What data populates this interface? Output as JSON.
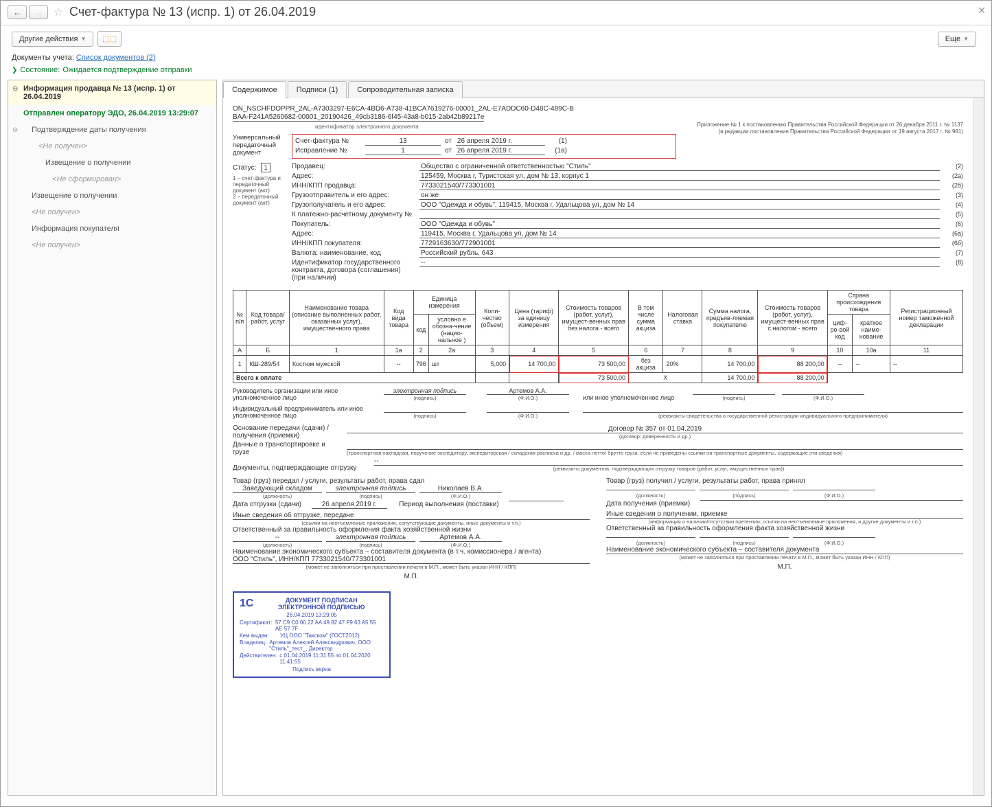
{
  "title": "Счет-фактура № 13 (испр. 1) от 26.04.2019",
  "toolbar": {
    "other_actions": "Другие действия",
    "more": "Еще"
  },
  "linkrow": {
    "label": "Документы учета:",
    "link": "Список документов (2)"
  },
  "statusrow": {
    "label": "Состояние:",
    "value": "Ожидается подтверждение отправки"
  },
  "sidebar": {
    "hdr1": "Информация продавца № 13 (испр. 1) от 26.04.2019",
    "hdr2": "Отправлен оператору ЭДО, 26.04.2019 13:29:07",
    "items": [
      {
        "label": "Подтверждение даты получения",
        "class": "side-indent",
        "bullet": "⊖"
      },
      {
        "label": "<Не получен>",
        "class": "side-faded"
      },
      {
        "label": "Извещение о получении",
        "class": "side-indent",
        "indent": "padding-left:54px"
      },
      {
        "label": "<Не сформирован>",
        "class": "side-faded",
        "indent": "padding-left:64px"
      },
      {
        "label": "Извещение о получении",
        "class": "side-indent"
      },
      {
        "label": "<Не получен>",
        "class": "side-faded2"
      },
      {
        "label": "Информация покупателя",
        "class": "side-indent"
      },
      {
        "label": "<Не получен>",
        "class": "side-faded2"
      }
    ]
  },
  "tabs": [
    {
      "label": "Содержимое",
      "active": true
    },
    {
      "label": "Подписи (1)",
      "active": false
    },
    {
      "label": "Сопроводительная записка",
      "active": false
    }
  ],
  "doc": {
    "file1": "ON_NSCHFDOPPR_2AL-A7303297-E6CA-4BD6-A738-41BCA7619276-00001_2AL-E7ADDC60-D48C-489C-B",
    "file2": "BAA-F241A5260682-00001_20190426_49cb3186-6f45-43a8-b015-2ab42b89217e",
    "file_cap": "идентификатор электронного документа",
    "appendix1": "Приложение № 1 к постановлению Правительства Российской Федерации от 26 декабря 2011 г. № 1137",
    "appendix2": "(в редакции постановления Правительства Российской Федерации от 19 августа 2017 г. № 981)",
    "upd_label": "Универсальный передаточный документ",
    "sf_label": "Счет-фактура №",
    "sf_num": "13",
    "sf_ot": "от",
    "sf_date": "26 апреля 2019 г.",
    "sf_lineno": "(1)",
    "ispr_label": "Исправление №",
    "ispr_num": "1",
    "ispr_date": "26 апреля 2019 г.",
    "ispr_lineno": "(1а)",
    "status_label": "Статус:",
    "status_val": "1",
    "status_note1": "1 – счет-фактура и передаточный документ (акт)",
    "status_note2": "2 – передаточный документ (акт)",
    "rows": [
      {
        "k": "Продавец:",
        "v": "Общество с ограниченной ответственностью \"Стиль\"",
        "n": "(2)"
      },
      {
        "k": "Адрес:",
        "v": "125459, Москва г, Туристская ул, дом № 13, корпус 1",
        "n": "(2а)"
      },
      {
        "k": "ИНН/КПП продавца:",
        "v": "7733021540/773301001",
        "n": "(2б)"
      },
      {
        "k": "Грузоотправитель и его адрес:",
        "v": "он же",
        "n": "(3)"
      },
      {
        "k": "Грузополучатель и его адрес:",
        "v": "ООО \"Одежда и обувь\", 119415, Москва г, Удальцова ул, дом № 14",
        "n": "(4)"
      },
      {
        "k": "К платежно-расчетному документу №",
        "v": "",
        "n": "(5)"
      },
      {
        "k": "Покупатель:",
        "v": "ООО \"Одежда и обувь\"",
        "n": "(6)"
      },
      {
        "k": "Адрес:",
        "v": "119415, Москва г, Удальцова ул, дом № 14",
        "n": "(6а)"
      },
      {
        "k": "ИНН/КПП покупателя:",
        "v": "7729163630/772901001",
        "n": "(6б)"
      },
      {
        "k": "Валюта: наименование, код",
        "v": "Российский рубль, 643",
        "n": "(7)"
      },
      {
        "k": "Идентификатор государственного контракта, договора (соглашения) (при наличии)",
        "v": "--",
        "n": "(8)"
      }
    ],
    "table_headers": {
      "npp": "№ п/п",
      "code": "Код товара/ работ, услуг",
      "name": "Наименование товара (описание выполненных работ, оказанных услуг), имущественного права",
      "kind": "Код вида товара",
      "unit": "Единица измерения",
      "unit_k": "код",
      "unit_v": "условно е обозна-чение (нацио-нальное )",
      "qty": "Коли-чество (объем)",
      "price": "Цена (тариф) за единицу измерения",
      "sum_wo": "Стоимость товаров (работ, услуг), имущест-венных прав без налога - всего",
      "akciz": "В том числе сумма акциза",
      "rate": "Налоговая ставка",
      "tax": "Сумма налога, предъяв-ляемая покупателю",
      "sum_w": "Стоимость товаров (работ, услуг), имущест-венных прав с налогом - всего",
      "country": "Страна происхождения товара",
      "c_code": "циф-ро-вой код",
      "c_name": "краткое наиме-нование",
      "reg": "Регистрационный номер таможенной декларации"
    },
    "table_nums": {
      "a": "А",
      "b": "Б",
      "1": "1",
      "1a": "1а",
      "2": "2",
      "2a": "2а",
      "3": "3",
      "4": "4",
      "5": "5",
      "6": "6",
      "7": "7",
      "8": "8",
      "9": "9",
      "10": "10",
      "10a": "10а",
      "11": "11"
    },
    "item": {
      "n": "1",
      "code": "КШ-289/54",
      "name": "Костюм мужской",
      "kind": "--",
      "ucode": "796",
      "uname": "шт",
      "qty": "5,000",
      "price": "14 700,00",
      "sum_wo": "73 500,00",
      "akciz": "без акциза",
      "rate": "20%",
      "tax": "14 700,00",
      "sum_w": "88 200,00",
      "ccode": "--",
      "cname": "--",
      "reg": "--"
    },
    "total": {
      "label": "Всего к оплате",
      "sum_wo": "73 500,00",
      "x": "Х",
      "tax": "14 700,00",
      "sum_w": "88 200,00"
    },
    "sig": {
      "ruk": "Руководитель организации или иное уполномоченное лицо",
      "ep": "электронная подпись",
      "fio1": "Артемов А.А.",
      "other": "или иное уполномоченное лицо",
      "ip": "Индивидуальный предприниматель или иное уполномоченное лицо",
      "podpis": "(подпись)",
      "fio": "(Ф.И.О.)",
      "rekv": "(реквизиты свидетельства о государственной  регистрации индивидуального предпринимателя)"
    },
    "osnov_label": "Основание передачи (сдачи) / получения (приемки)",
    "osnov_val": "Договор № 357 от 01.04.2019",
    "osnov_cap": "(договор; доверенность и др.)",
    "trans_label": "Данные о транспортировке и грузе",
    "trans_cap": "(транспортная накладная, поручение экспедитору, экспедиторская / складская расписка и др. / масса нетто/ брутто груза, если не приведены ссылки на транспортные документы, содержащие эти сведения)",
    "docs_label": "Документы, подтверждающие отгрузку",
    "docs_val": "--",
    "docs_cap": "(реквизиты документов, подтверждающих отгрузку товаров (работ, услуг, имущественных прав))",
    "left": {
      "hdr": "Товар (груз) передал / услуги, результаты работ, права сдал",
      "pos": "Заведующий складом",
      "fio": "Николаев В.А.",
      "pos_cap": "(должность)",
      "date_l": "Дата отгрузки (сдачи)",
      "date_v": "26 апреля 2019 г.",
      "period_l": "Период выполнения (поставки)",
      "other": "Иные сведения об отгрузке, передаче",
      "other_cap": "(ссылки на неотъемлемые приложения, сопутствующие документы, иные документы и т.п.)",
      "resp": "Ответственный за правильность оформления факта хозяйственной жизни",
      "resp_pos": "--",
      "resp_fio": "Артемов А.А.",
      "ek": "Наименование экономического субъекта – составителя документа (в т.ч. комиссионера / агента)",
      "ek_v": "ООО \"Стиль\", ИНН/КПП 7733021540/773301001",
      "ek_cap": "(может не заполняться при проставлении печати в М.П., может быть указан ИНН / КПП)",
      "mp": "М.П."
    },
    "right": {
      "hdr": "Товар (груз) получил / услуги, результаты работ, права принял",
      "date_l": "Дата получения (приемки)",
      "other": "Иные сведения о получении, приемке",
      "other_cap": "(информация о наличии/отсутствии претензии; ссылки на неотъемлемые приложения, и другие  документы и т.п.)",
      "resp": "Ответственный за правильность оформления факта хозяйственной жизни",
      "ek": "Наименование экономического субъекта – составителя документа",
      "ek_cap": "(может не заполняться при проставлении печати в М.П., может быть указан ИНН / КПП)",
      "mp": "М.П."
    },
    "stamp": {
      "title1": "ДОКУМЕНТ ПОДПИСАН",
      "title2": "ЭЛЕКТРОННОЙ ПОДПИСЬЮ",
      "date": "26.04.2019 13:29:05",
      "cert_k": "Сертификат:",
      "cert_v": "57 C9 C0 00 22 AA 49 82 47 F9 63 A5 55 AE 57 7F",
      "issuer_k": "Кем выдан:",
      "issuer_v": "УЦ ООО \"Такском\" (ГОСТ2012)",
      "owner_k": "Владелец:",
      "owner_v": "Артемов Алексей Александрович, ООО \"Стиль\"_тест_, Директор",
      "valid_k": "Действителен:",
      "valid_v": "с 01.04.2019 11:31:55 по 01.04.2020 11:41:55",
      "ok": "Подпись верна",
      "logo": "1С"
    }
  }
}
